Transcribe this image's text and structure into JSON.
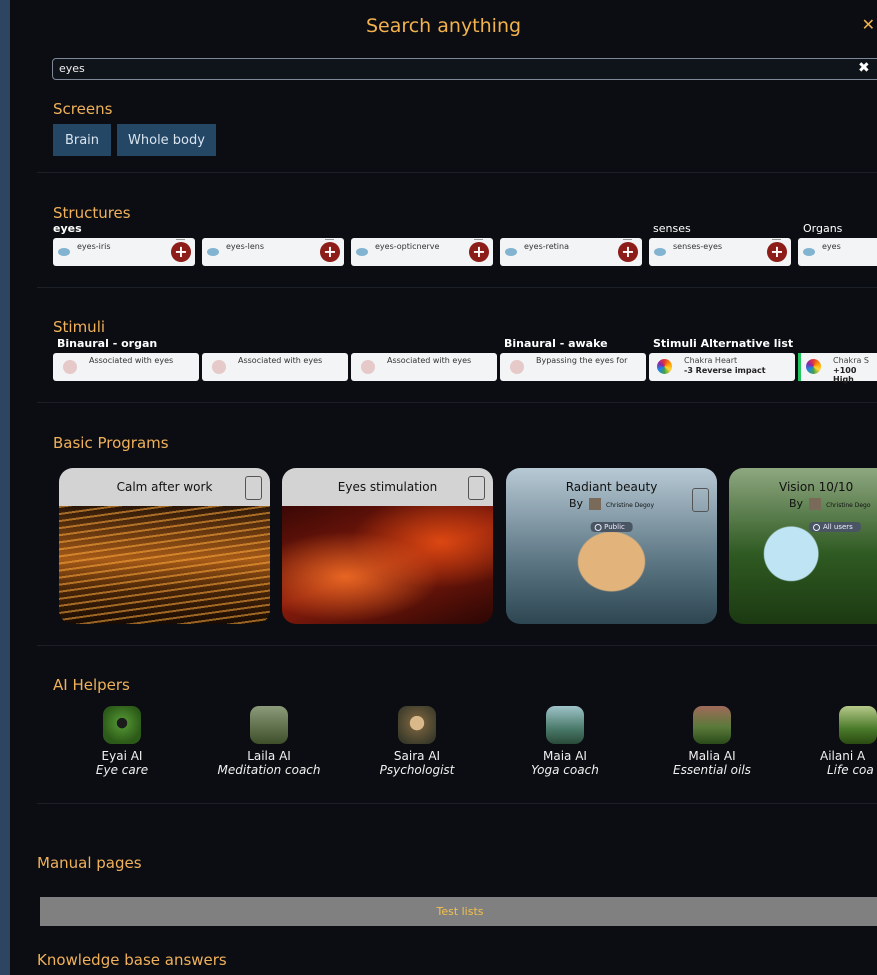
{
  "dialog": {
    "title": "Search anything",
    "close_icon": "close-icon"
  },
  "search": {
    "value": "eyes",
    "clear_icon": "clear-icon"
  },
  "screens": {
    "heading": "Screens",
    "buttons": [
      "Brain",
      "Whole body"
    ]
  },
  "structures": {
    "heading": "Structures",
    "groups": [
      "eyes",
      "senses",
      "Organs"
    ],
    "chips": [
      "eyes-iris",
      "eyes-lens",
      "eyes-opticnerve",
      "eyes-retina",
      "senses-eyes",
      "eyes"
    ]
  },
  "stimuli": {
    "heading": "Stimuli",
    "groups": [
      "Binaural - organ",
      "Binaural - awake",
      "Stimuli Alternative list"
    ],
    "chips": [
      "Associated with eyes",
      "Associated with eyes",
      "Associated with eyes",
      "Bypassing the eyes for"
    ],
    "alt_chips": [
      {
        "line1": "Chakra Heart",
        "line2": "-3 Reverse impact"
      },
      {
        "line1": "Chakra S",
        "line2": "+100 High"
      }
    ]
  },
  "basic_programs": {
    "heading": "Basic Programs",
    "cards": [
      {
        "title": "Calm after work"
      },
      {
        "title": "Eyes stimulation"
      },
      {
        "title": "Radiant beauty",
        "by": "By",
        "author": "Christine Degoy",
        "badge": "Public"
      },
      {
        "title": "Vision 10/10",
        "by": "By",
        "author": "Christine Dego",
        "badge": "All users"
      }
    ]
  },
  "ai_helpers": {
    "heading": "AI Helpers",
    "items": [
      {
        "name": "Eyai AI",
        "role": "Eye care",
        "color": "#3b6b2a"
      },
      {
        "name": "Laila AI",
        "role": "Meditation coach",
        "color": "#5a6b3a"
      },
      {
        "name": "Saira AI",
        "role": "Psychologist",
        "color": "#6b5a3a"
      },
      {
        "name": "Maia AI",
        "role": "Yoga coach",
        "color": "#4a7a6a"
      },
      {
        "name": "Malia AI",
        "role": "Essential oils",
        "color": "#5a7a3a"
      },
      {
        "name": "Ailani A",
        "role": "Life coa",
        "color": "#4a7a2a"
      }
    ]
  },
  "manual_pages": {
    "heading": "Manual pages",
    "items": [
      "Test lists"
    ]
  },
  "knowledge_base": {
    "heading": "Knowledge base answers"
  }
}
